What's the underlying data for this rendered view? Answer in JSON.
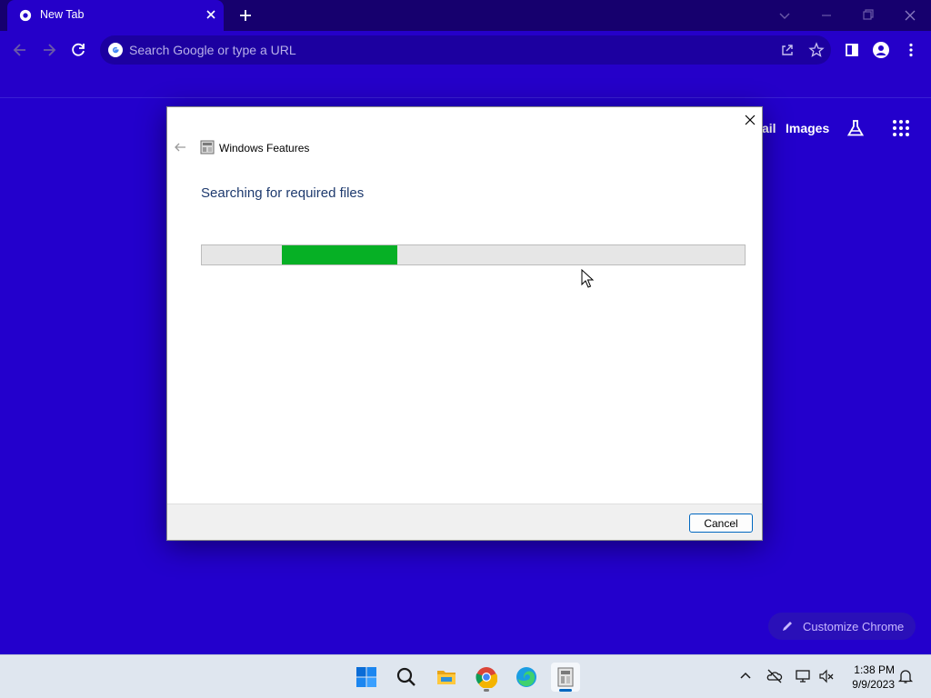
{
  "browser": {
    "tab": {
      "title": "New Tab"
    },
    "omnibox": {
      "placeholder": "Search Google or type a URL"
    },
    "ntp": {
      "links": [
        "ail",
        "Images"
      ],
      "customize_label": "Customize Chrome"
    },
    "colors": {
      "theme": "#2200cc",
      "frame": "#16006e"
    }
  },
  "dialog": {
    "title": "Windows Features",
    "heading": "Searching for required files",
    "progress": {
      "start": 0.147,
      "end": 0.36
    },
    "cancel_label": "Cancel",
    "colors": {
      "progress_fill": "#06b025",
      "heading": "#1e3a6e"
    }
  },
  "taskbar": {
    "apps": [
      "start-icon",
      "search-icon",
      "file-explorer-icon",
      "chrome-icon",
      "edge-icon",
      "windows-features-icon"
    ],
    "clock": {
      "time": "1:38 PM",
      "date": "9/9/2023"
    }
  }
}
